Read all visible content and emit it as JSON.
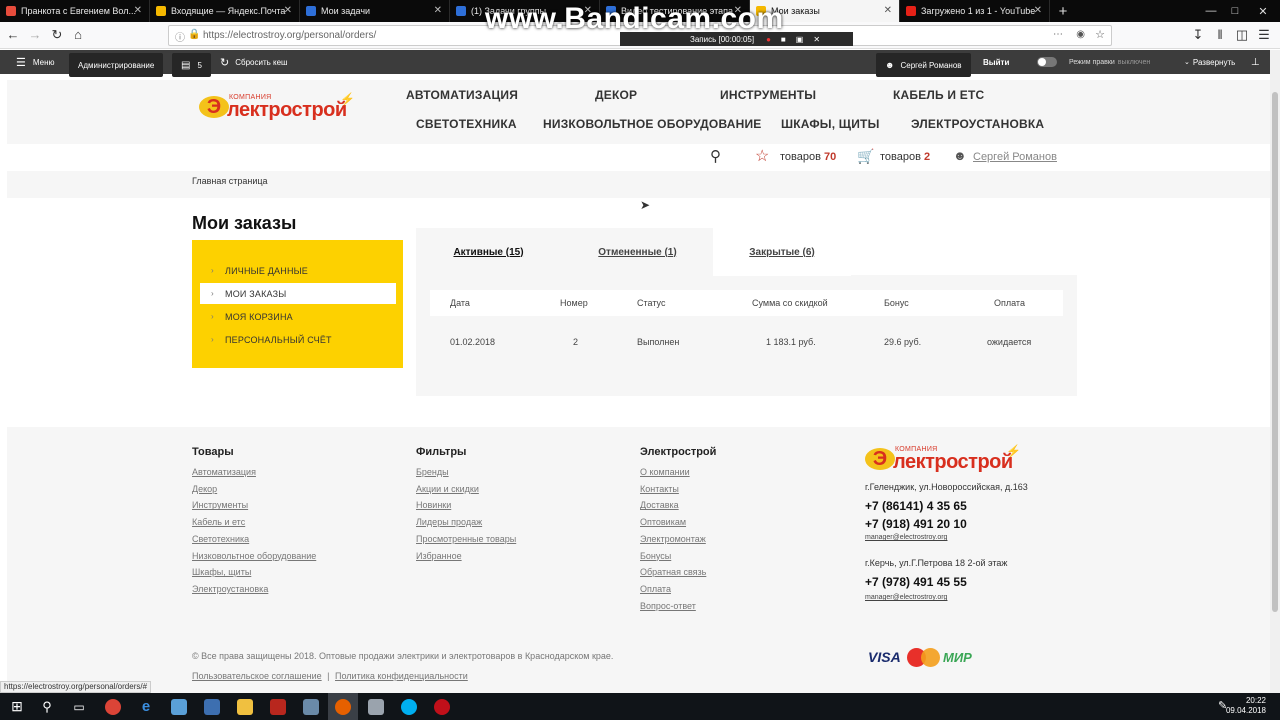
{
  "browser": {
    "tabs": [
      {
        "title": "Пранкота с Евгением Вол...",
        "color": "#e74c3c",
        "active": false
      },
      {
        "title": "Входящие — Яндекс.Почта",
        "color": "#f5b800",
        "active": false
      },
      {
        "title": "Мои задачи",
        "color": "#2e6fd8",
        "active": false
      },
      {
        "title": "(1) Задачи группы",
        "color": "#2e6fd8",
        "active": false
      },
      {
        "title": "Видео тестирование этапа",
        "color": "#2e6fd8",
        "active": false
      },
      {
        "title": "Мои заказы",
        "color": "#f5b800",
        "active": true
      },
      {
        "title": "Загружено 1 из 1 - YouTube",
        "color": "#e62117",
        "active": false
      }
    ],
    "new_tab": "+",
    "url": "https://electrostroy.org/personal/orders/",
    "status_url": "https://electrostroy.org/personal/orders/#"
  },
  "recorder": {
    "watermark": "www.Bandicam.com",
    "rec_label": "Запись [00:00:05]"
  },
  "admin": {
    "menu": "Меню",
    "administration": "Администрирование",
    "notifications": "5",
    "clear_cache": "Сбросить кеш",
    "user": "Сергей Романов",
    "logout": "Выйти",
    "edit_mode_label": "Режим правки",
    "edit_mode_state": "выключен",
    "expand": "Развернуть"
  },
  "site": {
    "logo_small": "КОМПАНИЯ",
    "logo_main": "лектрострой",
    "logo_letter": "Э",
    "menu": [
      "АВТОМАТИЗАЦИЯ",
      "ДЕКОР",
      "ИНСТРУМЕНТЫ",
      "КАБЕЛЬ И ЕТС",
      "СВЕТОТЕХНИКА",
      "НИЗКОВОЛЬТНОЕ ОБОРУДОВАНИЕ",
      "ШКАФЫ, ЩИТЫ",
      "ЭЛЕКТРОУСТАНОВКА"
    ],
    "favorites_label": "товаров",
    "favorites_count": "70",
    "cart_label": "товаров",
    "cart_count": "2",
    "profile_name": "Сергей Романов",
    "breadcrumb": "Главная страница",
    "page_title": "Мои заказы"
  },
  "sidebar": {
    "items": [
      {
        "label": "ЛИЧНЫЕ ДАННЫЕ",
        "active": false
      },
      {
        "label": "МОИ ЗАКАЗЫ",
        "active": true
      },
      {
        "label": "МОЯ КОРЗИНА",
        "active": false
      },
      {
        "label": "ПЕРСОНАЛЬНЫЙ СЧЁТ",
        "active": false
      }
    ]
  },
  "orders": {
    "tabs": [
      {
        "label": "Активные (15)",
        "active": true
      },
      {
        "label": "Отмененные (1)",
        "active": true
      },
      {
        "label": "Закрытые (6)",
        "active": false
      }
    ],
    "columns": [
      "Дата",
      "Номер",
      "Статус",
      "Сумма со скидкой",
      "Бонус",
      "Оплата"
    ],
    "rows": [
      [
        "01.02.2018",
        "2",
        "Выполнен",
        "1 183.1 руб.",
        "29.6 руб.",
        "ожидается"
      ]
    ]
  },
  "footer": {
    "col1": {
      "title": "Товары",
      "links": [
        "Автоматизация",
        "Декор",
        "Инструменты",
        "Кабель и етс",
        "Светотехника",
        "Низковольтное оборудование",
        "Шкафы, щиты",
        "Электроустановка"
      ]
    },
    "col2": {
      "title": "Фильтры",
      "links": [
        "Бренды",
        "Акции и скидки",
        "Новинки",
        "Лидеры продаж",
        "Просмотренные товары",
        "Избранное"
      ]
    },
    "col3": {
      "title": "Электрострой",
      "links": [
        "О компании",
        "Контакты",
        "Доставка",
        "Оптовикам",
        "Электромонтаж",
        "Бонусы",
        "Обратная связь",
        "Оплата",
        "Вопрос-ответ"
      ]
    },
    "contacts": {
      "addr1": "г.Геленджик, ул.Новороссийская, д.163",
      "phone1": "+7 (86141) 4 35 65",
      "phone2": "+7 (918) 491 20 10",
      "mail1": "manager@electrostroy.org",
      "addr2": "г.Керчь, ул.Г.Петрова 18 2-ой этаж",
      "phone3": "+7 (978) 491 45 55",
      "mail2": "manager@electrostroy.org"
    },
    "copyright": "© Все права защищены 2018. Оптовые продажи электрики и электротоваров в Краснодарском крае.",
    "agreement": "Пользовательское соглашение",
    "separator": "|",
    "privacy": "Политика конфиденциальности",
    "pay_visa": "VISA",
    "pay_mir": "МИР"
  },
  "taskbar": {
    "time": "20:22",
    "date": "09.04.2018"
  }
}
